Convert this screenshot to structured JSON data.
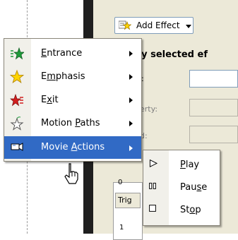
{
  "task_pane": {
    "add_effect_label": "Add Effect",
    "heading": "ify selected ef",
    "fields": [
      {
        "label": ":"
      },
      {
        "label": "erty:"
      },
      {
        "label": "d:"
      }
    ],
    "trig_label": "Trig",
    "row_number": "1",
    "row_number2": "0"
  },
  "add_effect_menu": {
    "items": [
      {
        "label": "Entrance",
        "accel": "E",
        "icon": "entrance-star-icon",
        "color": "#1f9a3a"
      },
      {
        "label": "Emphasis",
        "accel": "m",
        "icon": "emphasis-star-icon",
        "color": "#e8b400"
      },
      {
        "label": "Exit",
        "accel": "x",
        "icon": "exit-star-icon",
        "color": "#d21f1f"
      },
      {
        "label": "Motion Paths",
        "accel": "P",
        "icon": "motion-path-star-icon",
        "color": "#6d6d6d"
      },
      {
        "label": "Movie Actions",
        "accel": "A",
        "icon": "movie-actions-icon",
        "color": "#316ac5"
      }
    ]
  },
  "movie_actions_submenu": {
    "items": [
      {
        "label": "Play",
        "accel": "P",
        "icon": "play-icon"
      },
      {
        "label": "Pause",
        "accel": "s",
        "icon": "pause-icon"
      },
      {
        "label": "Stop",
        "accel": "o",
        "icon": "stop-icon"
      }
    ]
  },
  "colors": {
    "highlight": "#316ac5",
    "pane_background": "#ece9d8",
    "menu_border": "#8a867a"
  }
}
